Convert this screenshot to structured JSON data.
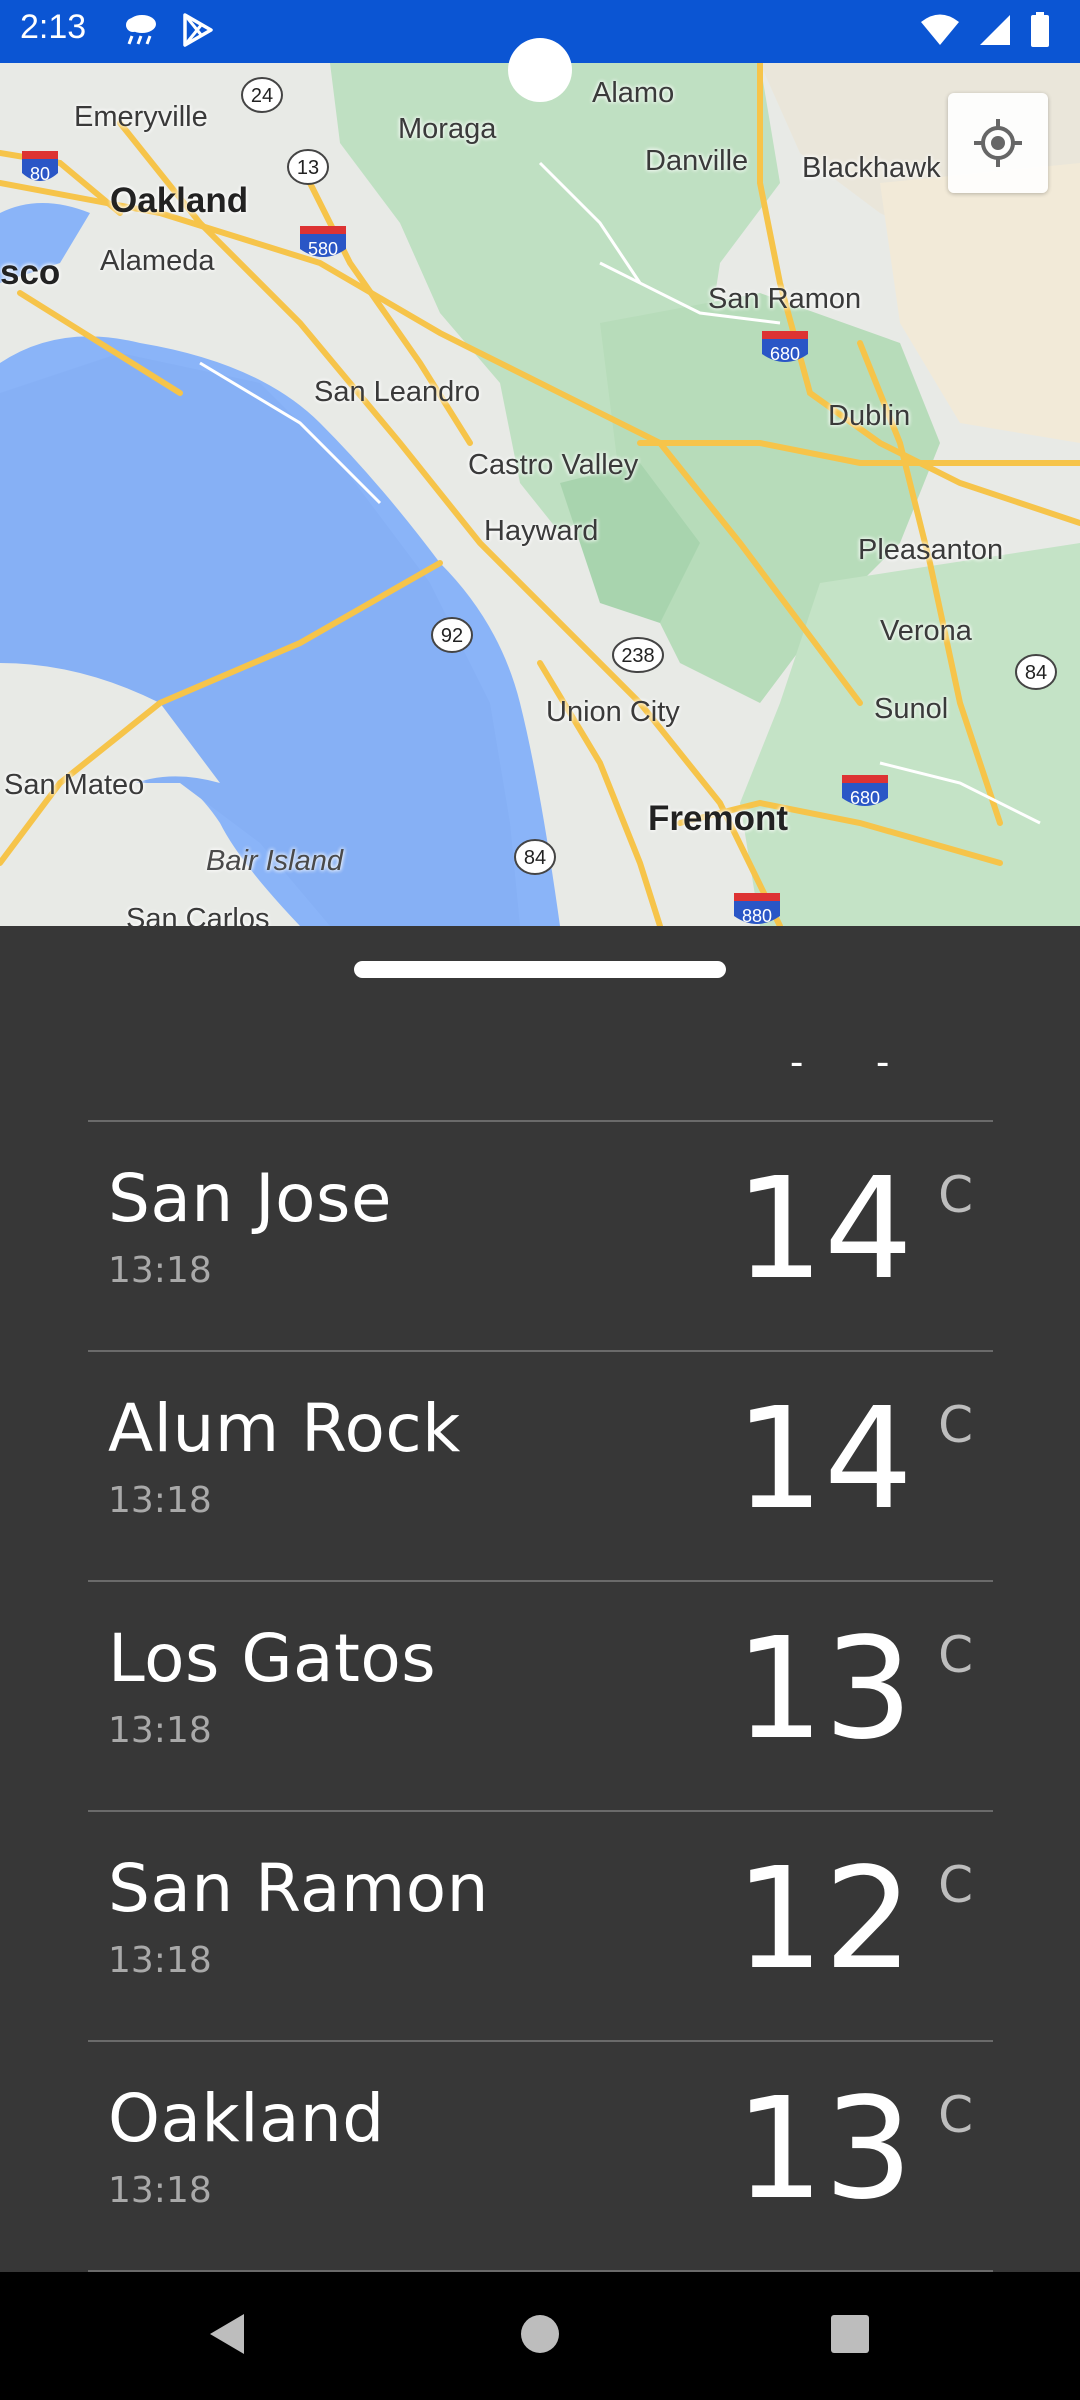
{
  "status_bar": {
    "time": "2:13",
    "icons_left": [
      "weather-rain-icon",
      "play-store-icon"
    ],
    "icons_right": [
      "wifi-icon",
      "cellular-icon",
      "battery-icon"
    ],
    "background": "#0b55d3"
  },
  "map": {
    "labels": {
      "emeryville": "Emeryville",
      "moraga": "Moraga",
      "alamo": "Alamo",
      "danville": "Danville",
      "blackhawk": "Blackhawk",
      "oakland": "Oakland",
      "sco": "sco",
      "alameda": "Alameda",
      "san_ramon": "San Ramon",
      "san_leandro": "San Leandro",
      "dublin": "Dublin",
      "castro_valley": "Castro Valley",
      "hayward": "Hayward",
      "pleasanton": "Pleasanton",
      "verona": "Verona",
      "union_city": "Union City",
      "sunol": "Sunol",
      "san_mateo": "San Mateo",
      "fremont": "Fremont",
      "bair_island": "Bair Island",
      "san_carlos": "San Carlos"
    },
    "shields": {
      "s24": "24",
      "s13": "13",
      "s80": "80",
      "s580": "580",
      "s680a": "680",
      "s92": "92",
      "s238": "238",
      "s84a": "84",
      "s680b": "680",
      "s84b": "84",
      "s880": "880"
    },
    "locate_button_icon": "my-location-icon"
  },
  "sheet": {
    "partial_row": {
      "dash1": "-",
      "dash2": "-"
    },
    "rows": [
      {
        "city": "San Jose",
        "time": "13:18",
        "temp": "14",
        "unit": "C"
      },
      {
        "city": "Alum Rock",
        "time": "13:18",
        "temp": "14",
        "unit": "C"
      },
      {
        "city": "Los Gatos",
        "time": "13:18",
        "temp": "13",
        "unit": "C"
      },
      {
        "city": "San Ramon",
        "time": "13:18",
        "temp": "12",
        "unit": "C"
      },
      {
        "city": "Oakland",
        "time": "13:18",
        "temp": "13",
        "unit": "C"
      }
    ]
  },
  "nav_bar": {
    "back_icon": "back-triangle-icon",
    "home_icon": "home-circle-icon",
    "recents_icon": "recents-square-icon"
  }
}
